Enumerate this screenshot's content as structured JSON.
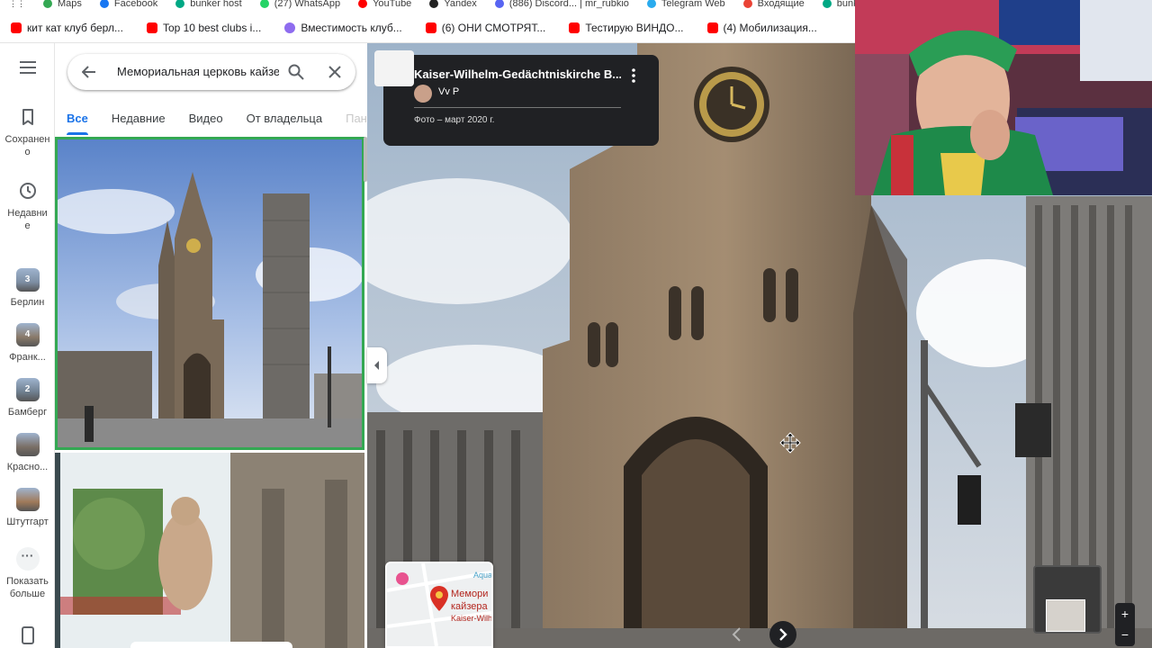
{
  "bookmarks_row1": [
    {
      "label": "Maps",
      "color": "#34a853"
    },
    {
      "label": "Facebook",
      "color": "#1877f2"
    },
    {
      "label": "bunker host",
      "color": "#00a884"
    },
    {
      "label": "(27) WhatsApp",
      "color": "#25d366"
    },
    {
      "label": "YouTube",
      "color": "#ff0000"
    },
    {
      "label": "Yandex",
      "color": "#222222"
    },
    {
      "label": "(886) Discord... | mr_rubkio",
      "color": "#5865f2"
    },
    {
      "label": "Telegram Web",
      "color": "#2aabee"
    },
    {
      "label": "Входящие",
      "color": "#ea4335"
    },
    {
      "label": "bunker database",
      "color": "#00a884"
    }
  ],
  "bookmarks_row2": [
    {
      "label": "кит кат клуб берл...",
      "color": "#ff0000"
    },
    {
      "label": "Top 10 best clubs i...",
      "color": "#ff0000"
    },
    {
      "label": "Вместимость клуб...",
      "color": "#8e6cef"
    },
    {
      "label": "(6) ОНИ СМОТРЯТ...",
      "color": "#ff0000"
    },
    {
      "label": "Тестирую ВИНДО...",
      "color": "#ff0000"
    },
    {
      "label": "(4) Мобилизация...",
      "color": "#ff0000"
    }
  ],
  "rail": {
    "saved_label": "Сохранено",
    "recent_label": "Недавние",
    "places": [
      {
        "label": "Берлин",
        "badge": "3"
      },
      {
        "label": "Франк...",
        "badge": "4"
      },
      {
        "label": "Бамберг",
        "badge": "2"
      },
      {
        "label": "Красно...",
        "badge": ""
      },
      {
        "label": "Штутгарт",
        "badge": ""
      }
    ],
    "more_label": "Показать больше"
  },
  "search": {
    "value": "Мемориальная церковь кайзе"
  },
  "tabs": [
    {
      "label": "Все",
      "active": true
    },
    {
      "label": "Недавние",
      "active": false
    },
    {
      "label": "Видео",
      "active": false
    },
    {
      "label": "От владельца",
      "active": false
    },
    {
      "label": "Пан",
      "active": false
    }
  ],
  "info_card": {
    "title": "Kaiser-Wilhelm-Gedächtniskirche B...",
    "user": "Vv P",
    "date": "Фото – март 2020 г."
  },
  "mini_map": {
    "label_line1": "Мемори",
    "label_line2": "кайзера",
    "label_line3": "Kaiser-Wilh",
    "label_top": "Aqua"
  },
  "zoom": {
    "plus": "+",
    "minus": "−"
  },
  "colors": {
    "accent": "#1a73e8",
    "selected_border": "#34a853",
    "card_bg": "#202124"
  }
}
